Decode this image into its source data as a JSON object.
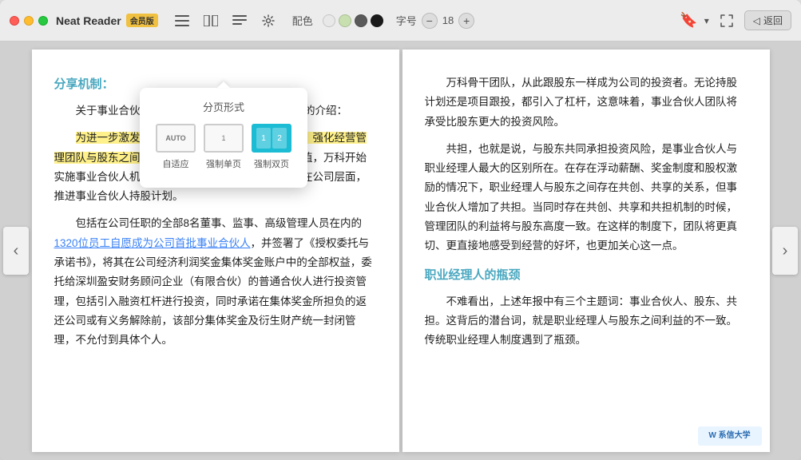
{
  "app": {
    "title": "Neat Reader",
    "vip_badge": "会员版",
    "back_label": "返回"
  },
  "toolbar": {
    "color_label": "配色",
    "font_label": "字号",
    "font_size": "18",
    "colors": [
      "#e8e8e8",
      "#d4e8c2",
      "#555555",
      "#222222"
    ],
    "bookmark_chevron": "▾"
  },
  "popup": {
    "title": "分页形式",
    "options": [
      {
        "id": "auto",
        "label": "自适应",
        "text": "AUTO"
      },
      {
        "id": "single",
        "label": "强制单页",
        "text": "1"
      },
      {
        "id": "double",
        "label": "强制双页",
        "text": "1  2",
        "active": true
      }
    ]
  },
  "left_page": {
    "section_title": "分享机制：",
    "paragraphs": [
      "关于事业合伙人机制，万科在2014年报中有简要的介绍：",
      "2014年，为进一步激发经营管理团队的工作热情和创造力，强化经营管理团队与股东之间紧密的联系，为公司创造更大的价值，万科开始实施事业合伙人机制。在项目层面，建立跟投机制；在公司层面，推进事业合伙人持股计划。",
      "包括在公司任职的全部8名董事、监事、高级管理人员在内的1320位员工自愿成为公司首批事业合伙人，并签署了《授权委托与承诺书》，将其在公司经济利润奖金集体奖金账户中的全部权益，委托给深圳盈安财务顾问企业（有限合伙）的普通合伙人进行投资管理，包括引入融资杠杆进行投资，同时承诺在集体奖金所担负的返还公司或有义务解除前，该部分集体奖金及衍生财产统一封闭管理，不允付到具体个人。"
    ]
  },
  "right_page": {
    "para1": "万科骨干团队，从此跟股东一样成为公司的投资者。无论持股计划还是项目跟投，都引入了杠杆，这意味着，事业合伙人团队将承受比股东更大的投资风险。",
    "para2": "共担，也就是说，与股东共同承担投资风险，是事业合伙人与职业经理人最大的区别所在。在存在浮动薪酬、奖金制度和股权激励的情况下，职业经理人与股东之间存在共创、共享的关系，但事业合伙人增加了共担。当同时存在共创、共享和共担机制的时候，管理团队的利益将与股东高度一致。在这样的制度下，团队将更真切、更直接地感受到经营的好坏，也更加关心这一点。",
    "section_title": "职业经理人的瓶颈",
    "para3": "不难看出，上述年报中有三个主题词：事业合伙人、股东、共担。这背后的潜台词，就是职业经理人与股东之间利益的不一致。传统职业经理人制度遇到了瓶颈。"
  }
}
